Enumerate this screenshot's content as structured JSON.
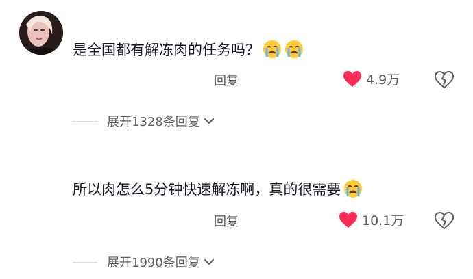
{
  "comments": [
    {
      "text": "是全国都有解冻肉的任务吗？",
      "emojis": [
        "crying-face-icon",
        "crying-face-icon"
      ],
      "reply_label": "回复",
      "likes": "4.9万",
      "expand_label": "展开1328条回复"
    },
    {
      "text": "所以肉怎么5分钟快速解冻啊，真的很需要",
      "emojis": [
        "crying-face-icon"
      ],
      "reply_label": "回复",
      "likes": "10.1万",
      "expand_label": "展开1990条回复"
    }
  ],
  "colors": {
    "heart": "#fe2c55",
    "secondary_text": "#5a5b63",
    "divider": "#dcdcdc"
  }
}
